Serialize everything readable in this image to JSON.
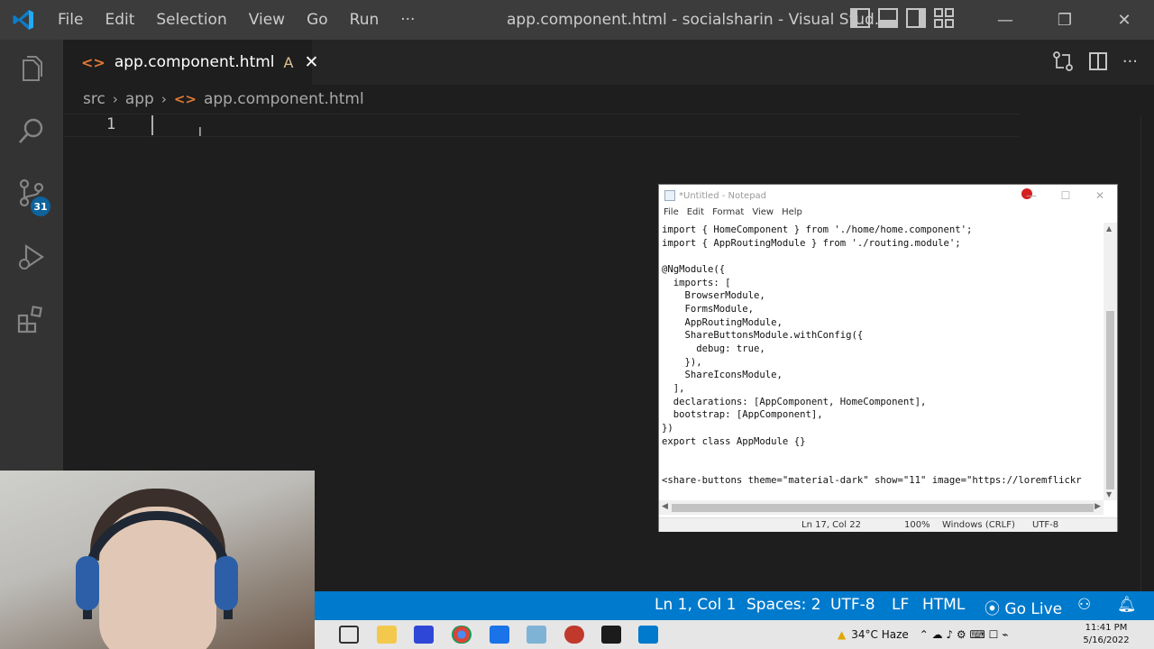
{
  "titlebar": {
    "menu": [
      "File",
      "Edit",
      "Selection",
      "View",
      "Go",
      "Run",
      "···"
    ],
    "window_title": "app.component.html - socialsharin - Visual Stud..."
  },
  "activitybar": {
    "items": [
      "explorer",
      "search",
      "source-control",
      "run-debug",
      "extensions"
    ],
    "scm_badge": "31"
  },
  "tab": {
    "name": "app.component.html",
    "status": "A",
    "close": "✕"
  },
  "breadcrumb": {
    "parts": [
      "src",
      "app",
      "app.component.html"
    ]
  },
  "editor": {
    "line_number": "1",
    "content": ""
  },
  "notepad": {
    "title": "*Untitled - Notepad",
    "menu": [
      "File",
      "Edit",
      "Format",
      "View",
      "Help"
    ],
    "lines": [
      "import { HomeComponent } from './home/home.component';",
      "import { AppRoutingModule } from './routing.module';",
      "",
      "@NgModule({",
      "  imports: [",
      "    BrowserModule,",
      "    FormsModule,",
      "    AppRoutingModule,",
      "    ShareButtonsModule.withConfig({",
      "      debug: true,",
      "    }),",
      "    ShareIconsModule,",
      "  ],",
      "  declarations: [AppComponent, HomeComponent],",
      "  bootstrap: [AppComponent],",
      "})",
      "export class AppModule {}",
      "",
      "",
      "<share-buttons theme=\"material-dark\" show=\"11\" image=\"https://loremflickr"
    ],
    "status": {
      "position": "Ln 17, Col 22",
      "zoom": "100%",
      "line_ending": "Windows (CRLF)",
      "encoding": "UTF-8"
    }
  },
  "statusbar": {
    "position": "Ln 1, Col 1",
    "spaces": "Spaces: 2",
    "encoding": "UTF-8",
    "eol": "LF",
    "language": "HTML",
    "go_live": "Go Live"
  },
  "taskbar": {
    "weather": "34°C Haze",
    "time": "11:41 PM",
    "date": "5/16/2022"
  },
  "colors": {
    "accent": "#007acc",
    "titlebar": "#3c3c3c",
    "activitybar": "#333333",
    "editor_bg": "#1e1e1e",
    "file_icon": "#e37933"
  }
}
